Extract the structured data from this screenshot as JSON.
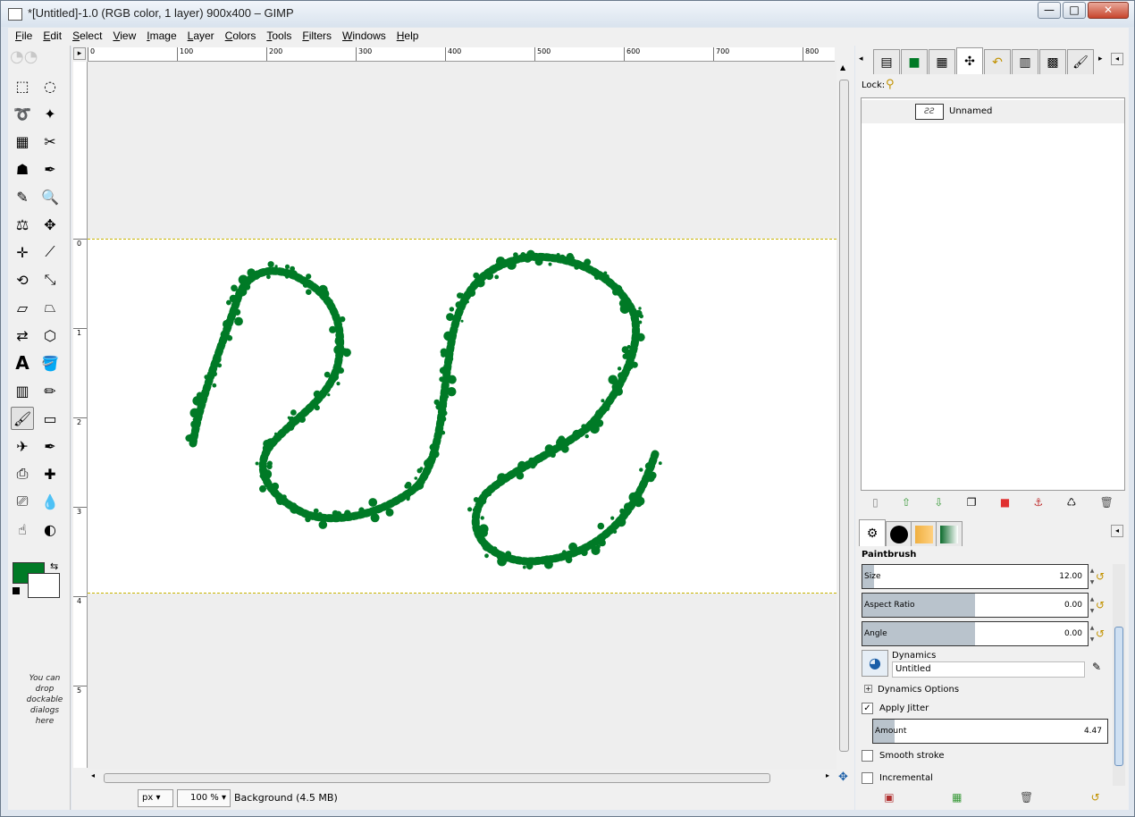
{
  "window": {
    "title": "*[Untitled]-1.0 (RGB color, 1 layer) 900x400 – GIMP",
    "controls": {
      "minimize": "—",
      "maximize": "□",
      "close": "✕"
    }
  },
  "menu": [
    "File",
    "Edit",
    "Select",
    "View",
    "Image",
    "Layer",
    "Colors",
    "Tools",
    "Filters",
    "Windows",
    "Help"
  ],
  "toolbox": {
    "icons": [
      "rect-select-icon",
      "ellipse-select-icon",
      "free-select-icon",
      "fuzzy-select-icon",
      "select-by-color-icon",
      "scissors-select-icon",
      "foreground-select-icon",
      "paths-icon",
      "color-picker-icon",
      "zoom-icon",
      "measure-icon",
      "move-icon",
      "align-icon",
      "crop-icon",
      "rotate-icon",
      "scale-icon",
      "shear-icon",
      "perspective-icon",
      "flip-icon",
      "cage-transform-icon",
      "text-icon",
      "bucket-fill-icon",
      "blend-icon",
      "pencil-icon",
      "paintbrush-icon",
      "eraser-icon",
      "airbrush-icon",
      "ink-icon",
      "clone-icon",
      "heal-icon",
      "perspective-clone-icon",
      "blur-icon",
      "smudge-icon",
      "dodge-burn-icon"
    ],
    "active_tool": "paintbrush-icon",
    "fg_color": "#007a26",
    "bg_color": "#ffffff",
    "drop_hint": "You can drop dockable dialogs here"
  },
  "image_window": {
    "ruler_h_labels": [
      "0",
      "100",
      "200",
      "300",
      "400",
      "500",
      "600",
      "700",
      "800"
    ],
    "ruler_v_labels": [
      "0",
      "1",
      "2",
      "3",
      "4",
      "5"
    ],
    "ruler_v_stubs": [
      "1",
      "0",
      "0",
      "2",
      "0",
      "0",
      "3",
      "0",
      "0",
      "4",
      "0",
      "0",
      "5",
      "0",
      "0"
    ],
    "stroke_color": "#007a26",
    "status": {
      "unit": "px",
      "zoom": "100 %",
      "info": "Background (4.5 MB)"
    }
  },
  "layers_dock": {
    "tab_icons": [
      "layers-tab-icon",
      "channels-color-tab-icon",
      "channels-tab-icon",
      "paths-tab-icon",
      "undo-history-tab-icon",
      "gradient-tab-icon",
      "palette-tab-icon",
      "brush-tab-icon"
    ],
    "lock_label": "Lock:",
    "layers": [
      {
        "name": "Unnamed"
      }
    ],
    "buttons": [
      "new-layer-icon",
      "raise-layer-icon",
      "lower-layer-icon",
      "duplicate-layer-icon",
      "delete-red-icon",
      "anchor-icon",
      "merge-icon",
      "trash-icon"
    ]
  },
  "tool_options": {
    "title": "Paintbrush",
    "size": {
      "label": "Size",
      "value": "12.00",
      "fill": 0.05
    },
    "aspect_ratio": {
      "label": "Aspect Ratio",
      "value": "0.00",
      "fill": 0.5
    },
    "angle": {
      "label": "Angle",
      "value": "0.00",
      "fill": 0.5
    },
    "dynamics": {
      "label": "Dynamics",
      "value": "Untitled"
    },
    "dynamics_options": "Dynamics Options",
    "apply_jitter": {
      "label": "Apply Jitter",
      "checked": true
    },
    "amount": {
      "label": "Amount",
      "value": "4.47",
      "fill": 0.09
    },
    "smooth_stroke": {
      "label": "Smooth stroke",
      "checked": false
    },
    "incremental": {
      "label": "Incremental",
      "checked": false
    },
    "footer_icons": [
      "save-options-icon",
      "restore-options-icon",
      "delete-options-icon",
      "reset-options-icon"
    ]
  }
}
